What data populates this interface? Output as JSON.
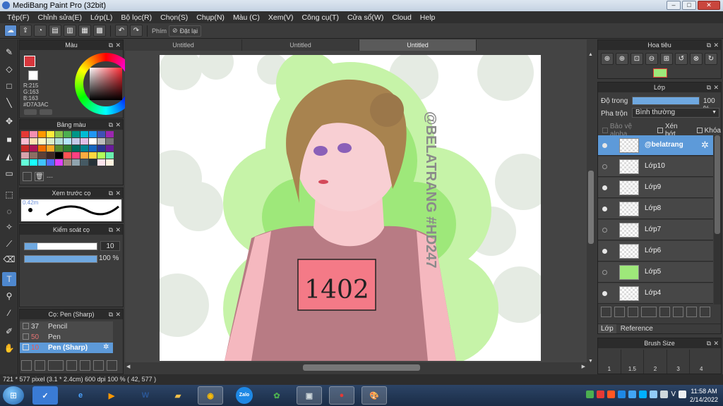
{
  "app": {
    "title": "MediBang Paint Pro (32bit)"
  },
  "window_buttons": {
    "min": "–",
    "max": "□",
    "close": "✕"
  },
  "menu": [
    "Tệp(F)",
    "Chỉnh sửa(E)",
    "Lớp(L)",
    "Bộ lọc(R)",
    "Chọn(S)",
    "Chụp(N)",
    "Màu (C)",
    "Xem(V)",
    "Công cụ(T)",
    "Cửa sổ(W)",
    "Cloud",
    "Help"
  ],
  "toolbar": {
    "label": "Phím",
    "reset": "Đặt lại"
  },
  "color_panel": {
    "title": "Màu",
    "r": "R:215",
    "g": "G:163",
    "b": "B:163",
    "hex": "#D7A3AC"
  },
  "swatch_panel": {
    "title": "Bảng màu",
    "empty_label": "---",
    "swatches": [
      "#e53935",
      "#f48fb1",
      "#ff9800",
      "#ffeb3b",
      "#8bc34a",
      "#4caf50",
      "#009688",
      "#00bcd4",
      "#2196f3",
      "#3f51b5",
      "#9c27b0",
      "#f8bbd0",
      "#ffe0b2",
      "#fff9c4",
      "#dcedc8",
      "#b2dfdb",
      "#b3e5fc",
      "#c5cae9",
      "#e1bee7",
      "#ffffff",
      "#bdbdbd",
      "#757575",
      "#c62828",
      "#ad1457",
      "#ef6c00",
      "#f9a825",
      "#558b2f",
      "#2e7d32",
      "#00695c",
      "#00838f",
      "#1565c0",
      "#283593",
      "#6a1b9a",
      "#d7a3ac",
      "#8d6e63",
      "#5d4037",
      "#3e2723",
      "#000000",
      "#ff5252",
      "#ff4081",
      "#ffab40",
      "#ffd740",
      "#b2ff59",
      "#69f0ae",
      "#64ffda",
      "#18ffff",
      "#40c4ff",
      "#536dfe",
      "#e040fb",
      "#a1887f",
      "#90a4ae",
      "#455a64",
      "#263238",
      "#fce4ec",
      "#fff3e0"
    ]
  },
  "brush_preview": {
    "title": "Xem trước cọ",
    "size": "0.42m"
  },
  "brush_control": {
    "title": "Kiểm soát cọ",
    "size": "10",
    "opacity": "100 %"
  },
  "brush_list": {
    "title": "Cọ: Pen (Sharp)",
    "items": [
      {
        "size": "37",
        "name": "Pencil"
      },
      {
        "size": "50",
        "name": "Pen"
      },
      {
        "size": "10",
        "name": "Pen (Sharp)"
      }
    ]
  },
  "doc_tabs": [
    "Untitled",
    "Untitled",
    "Untitled"
  ],
  "canvas": {
    "watermark": "@BELATRANG #HD247",
    "shirt_number": "1402"
  },
  "status": "721 * 577 pixel   (3.1 * 2.4cm)   600 dpi   100 %   ( 42, 577 )",
  "navigator": {
    "title": "Hoa tiêu"
  },
  "layer_panel": {
    "title": "Lớp",
    "opacity_label": "Độ trong",
    "opacity_value": "100 %",
    "opacity_fraction": 1.0,
    "blend_label": "Pha trộn",
    "blend_value": "Bình thường",
    "protect_alpha": "Bảo vệ alpha",
    "clipping": "Xén bớt",
    "lock": "Khóa",
    "layers": [
      "@belatrang",
      "Lớp10",
      "Lớp9",
      "Lớp8",
      "Lớp7",
      "Lớp6",
      "Lớp5",
      "Lớp4"
    ],
    "tabs": [
      "Lớp",
      "Reference"
    ]
  },
  "brush_size_panel": {
    "title": "Brush Size",
    "sizes": [
      "1",
      "1.5",
      "2",
      "3",
      "4"
    ]
  },
  "taskbar": {
    "time": "11:58 AM",
    "date": "2/14/2022",
    "zalo": "Zalo",
    "lang": "V"
  }
}
